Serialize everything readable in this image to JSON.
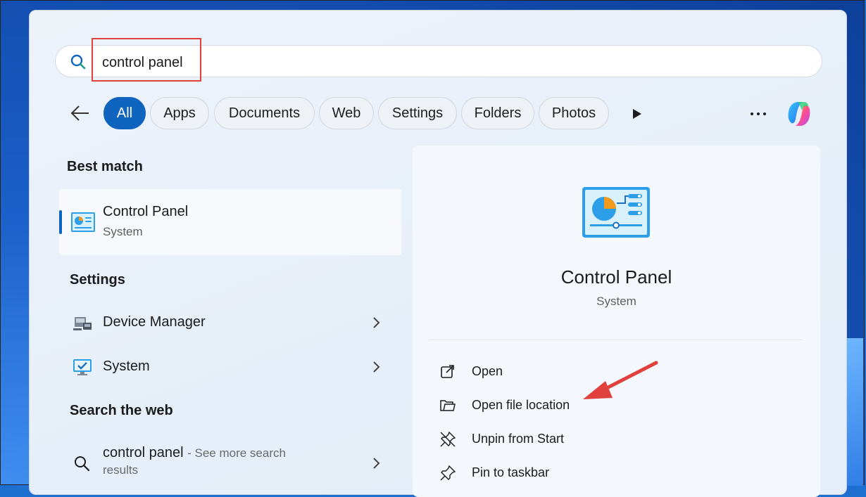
{
  "search": {
    "value": "control panel",
    "placeholder": ""
  },
  "filters": {
    "items": [
      "All",
      "Apps",
      "Documents",
      "Web",
      "Settings",
      "Folders",
      "Photos"
    ],
    "active": "All"
  },
  "left": {
    "best_match_heading": "Best match",
    "best_match": {
      "title": "Control Panel",
      "subtitle": "System"
    },
    "settings_heading": "Settings",
    "settings_items": [
      "Device Manager",
      "System"
    ],
    "web_heading": "Search the web",
    "web_item": {
      "query": "control panel",
      "hint": "- See more search",
      "tail": "results"
    }
  },
  "details": {
    "title": "Control Panel",
    "subtitle": "System",
    "actions": [
      "Open",
      "Open file location",
      "Unpin from Start",
      "Pin to taskbar"
    ]
  },
  "colors": {
    "accent": "#0f64bf",
    "annotation_red": "#e0413d"
  },
  "icons": {
    "search": "search-icon",
    "back": "arrow-left-icon",
    "more_filters": "play-icon",
    "more_options": "more-horizontal-icon",
    "copilot": "copilot-icon",
    "control_panel": "control-panel-icon",
    "device_manager": "device-manager-icon",
    "system": "system-monitor-icon",
    "open": "open-external-icon",
    "open_file_location": "folder-icon",
    "unpin": "unpin-icon",
    "pin": "pin-icon"
  }
}
